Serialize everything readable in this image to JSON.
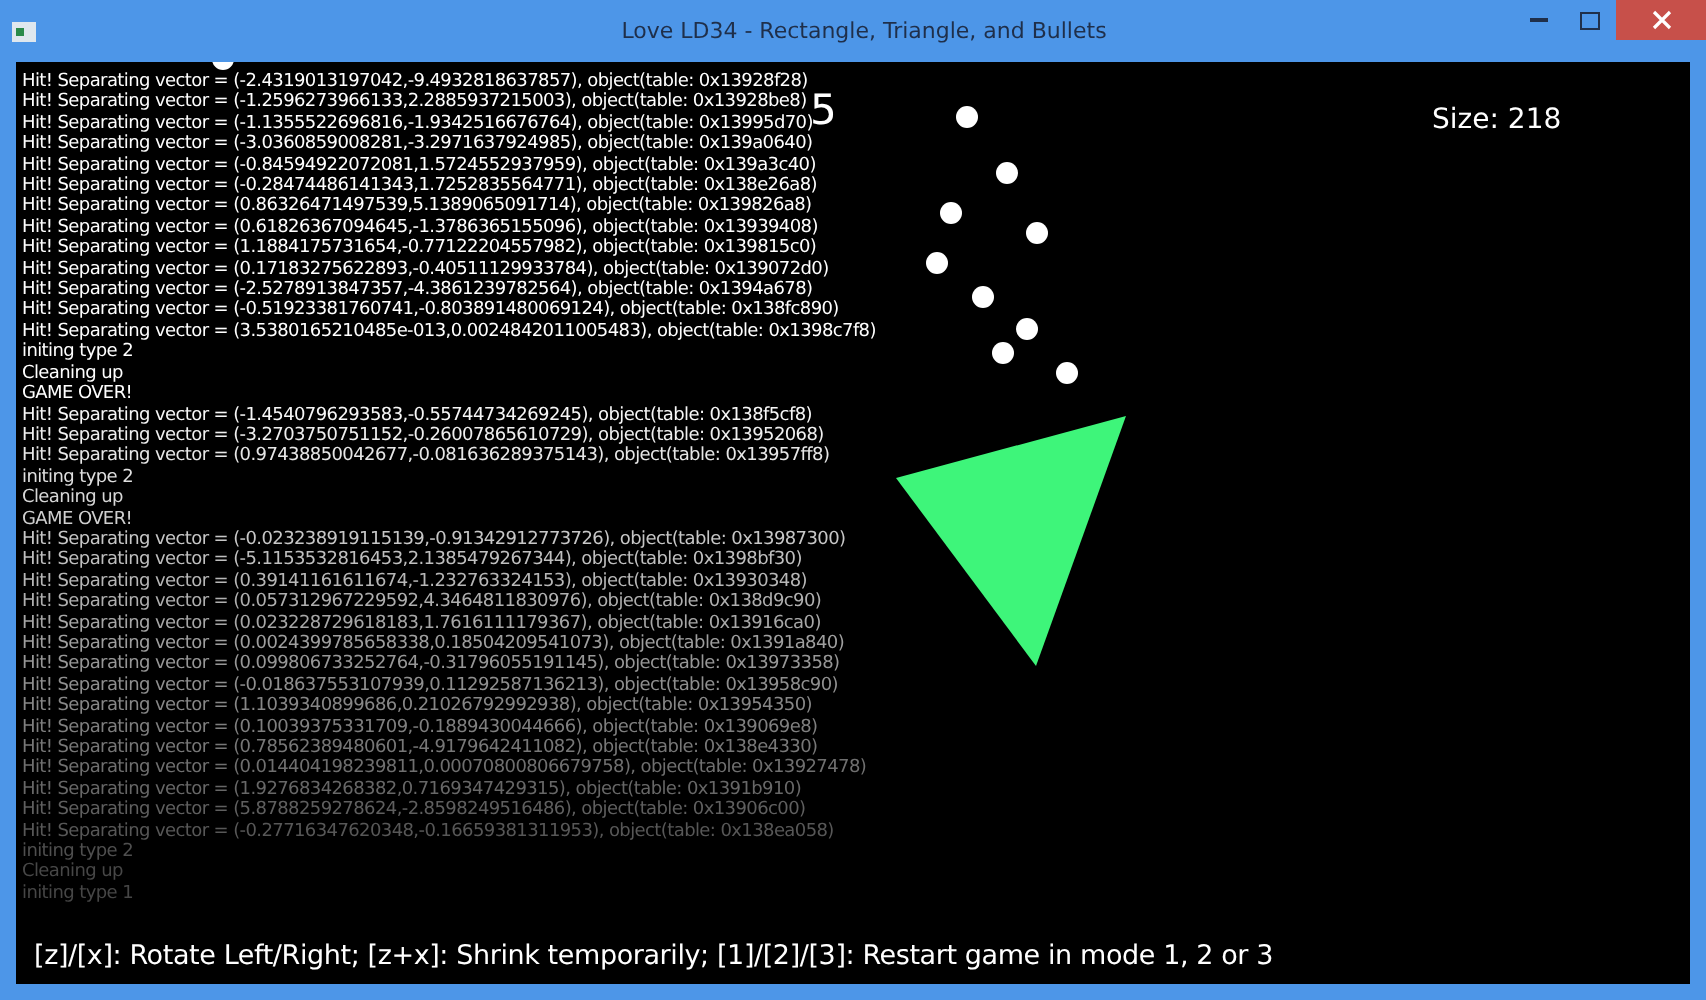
{
  "window": {
    "title": "Love LD34 - Rectangle, Triangle, and Bullets"
  },
  "log": [
    "Hit! Separating vector = (-2.4319013197042,-9.4932818637857), object(table: 0x13928f28)",
    "Hit! Separating vector = (-1.2596273966133,2.2885937215003), object(table: 0x13928be8)",
    "Hit! Separating vector = (-1.1355522696816,-1.9342516676764), object(table: 0x13995d70)",
    "Hit! Separating vector = (-3.0360859008281,-3.2971637924985), object(table: 0x139a0640)",
    "Hit! Separating vector = (-0.84594922072081,1.5724552937959), object(table: 0x139a3c40)",
    "Hit! Separating vector = (-0.28474486141343,1.7252835564771), object(table: 0x138e26a8)",
    "Hit! Separating vector = (0.86326471497539,5.1389065091714), object(table: 0x139826a8)",
    "Hit! Separating vector = (0.61826367094645,-1.3786365155096), object(table: 0x13939408)",
    "Hit! Separating vector = (1.1884175731654,-0.77122204557982), object(table: 0x139815c0)",
    "Hit! Separating vector = (0.17183275622893,-0.40511129933784), object(table: 0x139072d0)",
    "Hit! Separating vector = (-2.5278913847357,-4.3861239782564), object(table: 0x1394a678)",
    "Hit! Separating vector = (-0.51923381760741,-0.803891480069124), object(table: 0x138fc890)",
    "Hit! Separating vector = (3.5380165210485e-013,0.0024842011005483), object(table: 0x1398c7f8)",
    "initing type 2",
    "Cleaning up",
    "GAME OVER!",
    "Hit! Separating vector = (-1.4540796293583,-0.55744734269245), object(table: 0x138f5cf8)",
    "Hit! Separating vector = (-3.2703750751152,-0.26007865610729), object(table: 0x13952068)",
    "Hit! Separating vector = (0.97438850042677,-0.081636289375143), object(table: 0x13957ff8)",
    "initing type 2",
    "Cleaning up",
    "GAME OVER!",
    "Hit! Separating vector = (-0.023238919115139,-0.91342912773726), object(table: 0x13987300)",
    "Hit! Separating vector = (-5.1153532816453,2.1385479267344), object(table: 0x1398bf30)",
    "Hit! Separating vector = (0.39141161611674,-1.232763324153), object(table: 0x13930348)",
    "Hit! Separating vector = (0.057312967229592,4.3464811830976), object(table: 0x138d9c90)",
    "Hit! Separating vector = (0.023228729618183,1.7616111179367), object(table: 0x13916ca0)",
    "Hit! Separating vector = (0.0024399785658338,0.18504209541073), object(table: 0x1391a840)",
    "Hit! Separating vector = (0.099806733252764,-0.31796055191145), object(table: 0x13973358)",
    "Hit! Separating vector = (-0.018637553107939,0.11292587136213), object(table: 0x13958c90)",
    "Hit! Separating vector = (1.1039340899686,0.21026792992938), object(table: 0x13954350)",
    "Hit! Separating vector = (0.10039375331709,-0.1889430044666), object(table: 0x139069e8)",
    "Hit! Separating vector = (0.78562389480601,-4.9179642411082), object(table: 0x138e4330)",
    "Hit! Separating vector = (0.014404198239811,0.00070800806679758), object(table: 0x13927478)",
    "Hit! Separating vector = (1.9276834268382,0.7169347429315), object(table: 0x1391b910)",
    "Hit! Separating vector = (5.8788259278624,-2.8598249516486), object(table: 0x13906c00)",
    "Hit! Separating vector = (-0.27716347620348,-0.16659381311953), object(table: 0x138ea058)",
    "initing type 2",
    "Cleaning up",
    "initing type 1"
  ],
  "score": "5",
  "size": "Size: 218",
  "help": "[z]/[x]: Rotate Left/Right; [z+x]: Shrink temporarily; [1]/[2]/[3]: Restart game in mode 1, 2 or 3"
}
